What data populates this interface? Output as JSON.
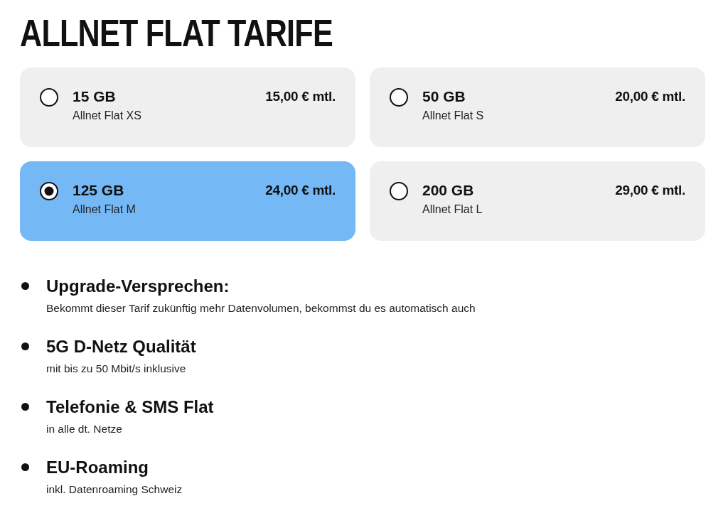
{
  "title": "ALLNET FLAT TARIFE",
  "plans": [
    {
      "data": "15 GB",
      "name": "Allnet Flat XS",
      "price": "15,00 € mtl.",
      "selected": false
    },
    {
      "data": "50 GB",
      "name": "Allnet Flat S",
      "price": "20,00 € mtl.",
      "selected": false
    },
    {
      "data": "125 GB",
      "name": "Allnet Flat M",
      "price": "24,00 € mtl.",
      "selected": true
    },
    {
      "data": "200 GB",
      "name": "Allnet Flat L",
      "price": "29,00 € mtl.",
      "selected": false
    }
  ],
  "features": [
    {
      "title": "Upgrade-Versprechen:",
      "description": "Bekommt dieser Tarif zukünftig mehr Datenvolumen, bekommst du es automatisch auch"
    },
    {
      "title": "5G D-Netz Qualität",
      "description": "mit bis zu 50 Mbit/s inklusive"
    },
    {
      "title": "Telefonie & SMS Flat",
      "description": "in alle dt. Netze"
    },
    {
      "title": "EU-Roaming",
      "description": "inkl. Datenroaming Schweiz"
    }
  ]
}
